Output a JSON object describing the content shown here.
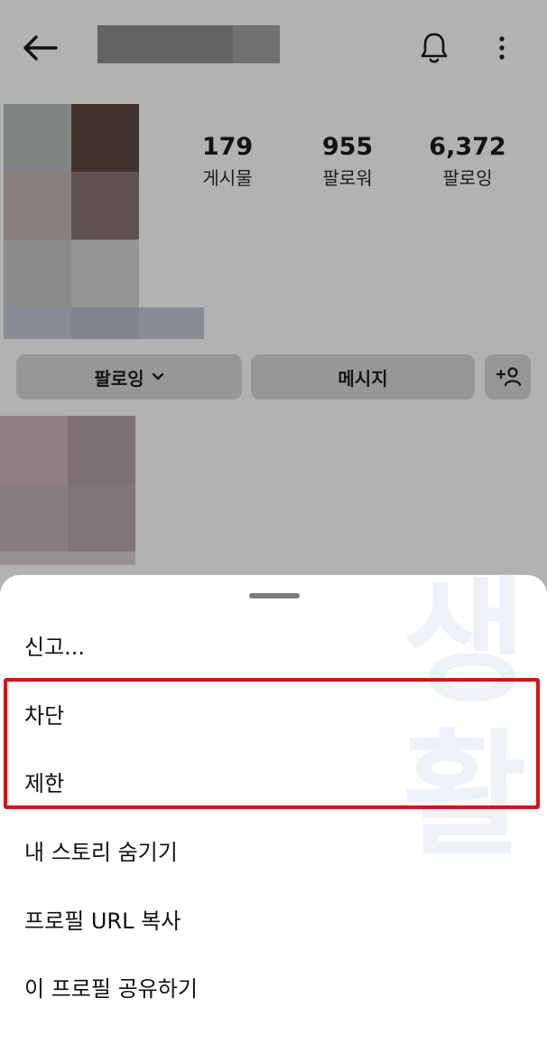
{
  "profile": {
    "stats": [
      {
        "value": "179",
        "label": "게시물"
      },
      {
        "value": "955",
        "label": "팔로워"
      },
      {
        "value": "6,372",
        "label": "팔로잉"
      }
    ],
    "follow_label": "팔로잉",
    "message_label": "메시지"
  },
  "sheet": {
    "items": [
      {
        "label": "신고..."
      },
      {
        "label": "차단"
      },
      {
        "label": "제한"
      },
      {
        "label": "내 스토리 숨기기"
      },
      {
        "label": "프로필 URL 복사"
      },
      {
        "label": "이 프로필 공유하기"
      }
    ],
    "highlight_color": "#d6111b"
  },
  "icons": [
    "back-arrow-icon",
    "bell-icon",
    "more-vertical-icon",
    "chevron-down-icon",
    "add-user-icon"
  ]
}
